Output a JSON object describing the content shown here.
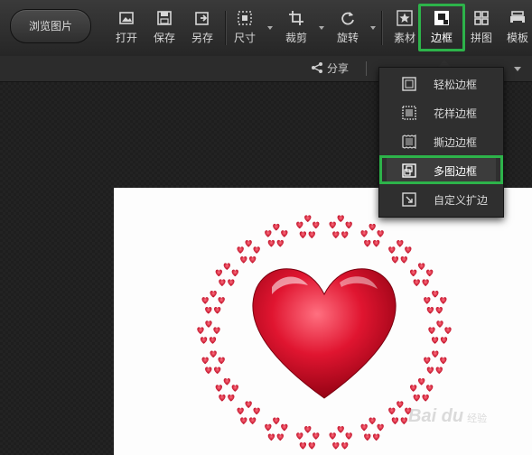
{
  "toolbar": {
    "browse_label": "浏览图片",
    "tools": [
      {
        "id": "open",
        "label": "打开",
        "icon": "open-image-icon"
      },
      {
        "id": "save",
        "label": "保存",
        "icon": "save-icon"
      },
      {
        "id": "saveas",
        "label": "另存",
        "icon": "save-as-icon"
      },
      {
        "id": "size",
        "label": "尺寸",
        "icon": "resize-icon"
      },
      {
        "id": "crop",
        "label": "裁剪",
        "icon": "crop-icon"
      },
      {
        "id": "rotate",
        "label": "旋转",
        "icon": "rotate-icon"
      },
      {
        "id": "material",
        "label": "素材",
        "icon": "star-material-icon"
      },
      {
        "id": "border",
        "label": "边框",
        "icon": "border-icon"
      },
      {
        "id": "collage",
        "label": "拼图",
        "icon": "grid-collage-icon"
      },
      {
        "id": "template",
        "label": "模板",
        "icon": "template-icon"
      }
    ],
    "active_tool": "边框",
    "highlight_color": "#2db34a"
  },
  "subbar": {
    "share_label": "分享"
  },
  "border_menu": {
    "items": [
      {
        "label": "轻松边框",
        "icon": "simple-border-icon"
      },
      {
        "label": "花样边框",
        "icon": "pattern-border-icon"
      },
      {
        "label": "撕边边框",
        "icon": "torn-edge-border-icon"
      },
      {
        "label": "多图边框",
        "icon": "multi-image-border-icon"
      },
      {
        "label": "自定义扩边",
        "icon": "custom-expand-icon"
      }
    ],
    "highlighted_item": "多图边框"
  },
  "watermark": {
    "text": "Bai du",
    "suffix": "经验"
  }
}
